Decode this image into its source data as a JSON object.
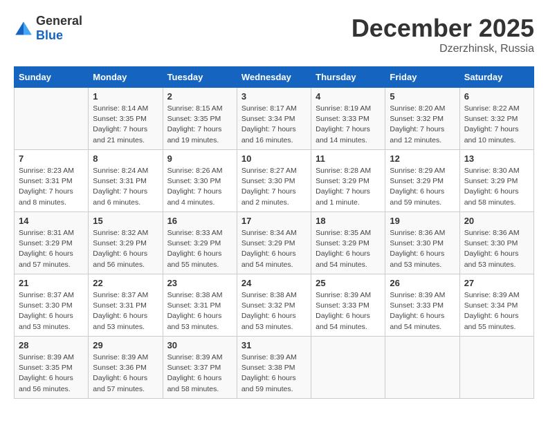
{
  "header": {
    "logo_general": "General",
    "logo_blue": "Blue",
    "month": "December 2025",
    "location": "Dzerzhinsk, Russia"
  },
  "days_of_week": [
    "Sunday",
    "Monday",
    "Tuesday",
    "Wednesday",
    "Thursday",
    "Friday",
    "Saturday"
  ],
  "weeks": [
    [
      {
        "day": "",
        "info": ""
      },
      {
        "day": "1",
        "info": "Sunrise: 8:14 AM\nSunset: 3:35 PM\nDaylight: 7 hours\nand 21 minutes."
      },
      {
        "day": "2",
        "info": "Sunrise: 8:15 AM\nSunset: 3:35 PM\nDaylight: 7 hours\nand 19 minutes."
      },
      {
        "day": "3",
        "info": "Sunrise: 8:17 AM\nSunset: 3:34 PM\nDaylight: 7 hours\nand 16 minutes."
      },
      {
        "day": "4",
        "info": "Sunrise: 8:19 AM\nSunset: 3:33 PM\nDaylight: 7 hours\nand 14 minutes."
      },
      {
        "day": "5",
        "info": "Sunrise: 8:20 AM\nSunset: 3:32 PM\nDaylight: 7 hours\nand 12 minutes."
      },
      {
        "day": "6",
        "info": "Sunrise: 8:22 AM\nSunset: 3:32 PM\nDaylight: 7 hours\nand 10 minutes."
      }
    ],
    [
      {
        "day": "7",
        "info": "Sunrise: 8:23 AM\nSunset: 3:31 PM\nDaylight: 7 hours\nand 8 minutes."
      },
      {
        "day": "8",
        "info": "Sunrise: 8:24 AM\nSunset: 3:31 PM\nDaylight: 7 hours\nand 6 minutes."
      },
      {
        "day": "9",
        "info": "Sunrise: 8:26 AM\nSunset: 3:30 PM\nDaylight: 7 hours\nand 4 minutes."
      },
      {
        "day": "10",
        "info": "Sunrise: 8:27 AM\nSunset: 3:30 PM\nDaylight: 7 hours\nand 2 minutes."
      },
      {
        "day": "11",
        "info": "Sunrise: 8:28 AM\nSunset: 3:29 PM\nDaylight: 7 hours\nand 1 minute."
      },
      {
        "day": "12",
        "info": "Sunrise: 8:29 AM\nSunset: 3:29 PM\nDaylight: 6 hours\nand 59 minutes."
      },
      {
        "day": "13",
        "info": "Sunrise: 8:30 AM\nSunset: 3:29 PM\nDaylight: 6 hours\nand 58 minutes."
      }
    ],
    [
      {
        "day": "14",
        "info": "Sunrise: 8:31 AM\nSunset: 3:29 PM\nDaylight: 6 hours\nand 57 minutes."
      },
      {
        "day": "15",
        "info": "Sunrise: 8:32 AM\nSunset: 3:29 PM\nDaylight: 6 hours\nand 56 minutes."
      },
      {
        "day": "16",
        "info": "Sunrise: 8:33 AM\nSunset: 3:29 PM\nDaylight: 6 hours\nand 55 minutes."
      },
      {
        "day": "17",
        "info": "Sunrise: 8:34 AM\nSunset: 3:29 PM\nDaylight: 6 hours\nand 54 minutes."
      },
      {
        "day": "18",
        "info": "Sunrise: 8:35 AM\nSunset: 3:29 PM\nDaylight: 6 hours\nand 54 minutes."
      },
      {
        "day": "19",
        "info": "Sunrise: 8:36 AM\nSunset: 3:30 PM\nDaylight: 6 hours\nand 53 minutes."
      },
      {
        "day": "20",
        "info": "Sunrise: 8:36 AM\nSunset: 3:30 PM\nDaylight: 6 hours\nand 53 minutes."
      }
    ],
    [
      {
        "day": "21",
        "info": "Sunrise: 8:37 AM\nSunset: 3:30 PM\nDaylight: 6 hours\nand 53 minutes."
      },
      {
        "day": "22",
        "info": "Sunrise: 8:37 AM\nSunset: 3:31 PM\nDaylight: 6 hours\nand 53 minutes."
      },
      {
        "day": "23",
        "info": "Sunrise: 8:38 AM\nSunset: 3:31 PM\nDaylight: 6 hours\nand 53 minutes."
      },
      {
        "day": "24",
        "info": "Sunrise: 8:38 AM\nSunset: 3:32 PM\nDaylight: 6 hours\nand 53 minutes."
      },
      {
        "day": "25",
        "info": "Sunrise: 8:39 AM\nSunset: 3:33 PM\nDaylight: 6 hours\nand 54 minutes."
      },
      {
        "day": "26",
        "info": "Sunrise: 8:39 AM\nSunset: 3:33 PM\nDaylight: 6 hours\nand 54 minutes."
      },
      {
        "day": "27",
        "info": "Sunrise: 8:39 AM\nSunset: 3:34 PM\nDaylight: 6 hours\nand 55 minutes."
      }
    ],
    [
      {
        "day": "28",
        "info": "Sunrise: 8:39 AM\nSunset: 3:35 PM\nDaylight: 6 hours\nand 56 minutes."
      },
      {
        "day": "29",
        "info": "Sunrise: 8:39 AM\nSunset: 3:36 PM\nDaylight: 6 hours\nand 57 minutes."
      },
      {
        "day": "30",
        "info": "Sunrise: 8:39 AM\nSunset: 3:37 PM\nDaylight: 6 hours\nand 58 minutes."
      },
      {
        "day": "31",
        "info": "Sunrise: 8:39 AM\nSunset: 3:38 PM\nDaylight: 6 hours\nand 59 minutes."
      },
      {
        "day": "",
        "info": ""
      },
      {
        "day": "",
        "info": ""
      },
      {
        "day": "",
        "info": ""
      }
    ]
  ]
}
